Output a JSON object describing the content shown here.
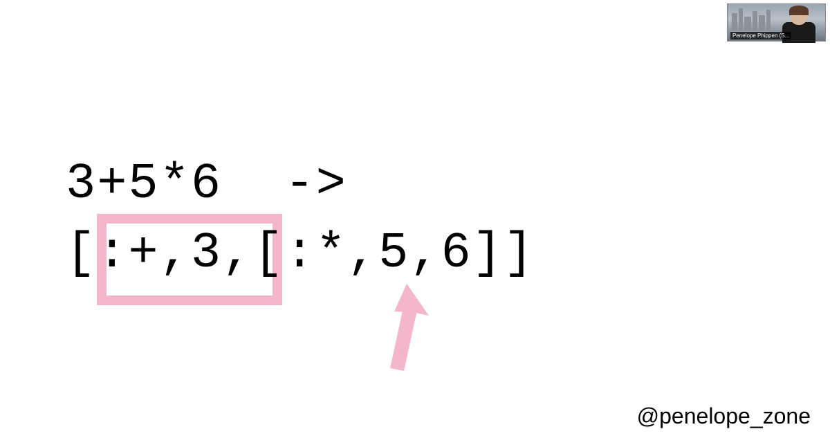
{
  "slide": {
    "line1": "3+5*6  ->",
    "line2": "[:+,3,[:*,5,6]]"
  },
  "speaker": {
    "name_label": "Penelope Phippen (S..."
  },
  "footer": {
    "handle": "@penelope_zone"
  },
  "accent_color": "#f4b6cd"
}
